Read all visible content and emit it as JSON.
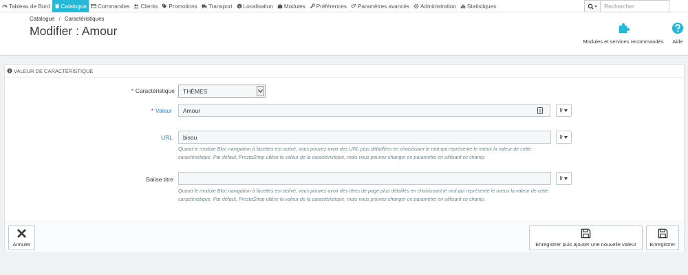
{
  "nav": {
    "tabs": [
      {
        "label": "Tableau de Bord",
        "icon": "speedometer-icon"
      },
      {
        "label": "Catalogue",
        "icon": "book-icon",
        "active": true
      },
      {
        "label": "Commandes",
        "icon": "credit-card-icon"
      },
      {
        "label": "Clients",
        "icon": "users-icon"
      },
      {
        "label": "Promotions",
        "icon": "tag-icon"
      },
      {
        "label": "Transport",
        "icon": "truck-icon"
      },
      {
        "label": "Localisation",
        "icon": "globe-icon"
      },
      {
        "label": "Modules",
        "icon": "puzzle-icon"
      },
      {
        "label": "Préférences",
        "icon": "wrench-icon"
      },
      {
        "label": "Paramètres avancés",
        "icon": "cogs-icon"
      },
      {
        "label": "Administration",
        "icon": "gear-icon"
      },
      {
        "label": "Statistiques",
        "icon": "bar-chart-icon"
      }
    ],
    "search_placeholder": "Rechercher"
  },
  "header": {
    "breadcrumb": [
      "Catalogue",
      "Caractéristiques"
    ],
    "breadcrumb_sep": "/",
    "title": "Modifier : Amour",
    "modules_label": "Modules et services recommandés",
    "help_label": "Aide"
  },
  "panel": {
    "heading": "VALEUR DE CARACTÉRISTIQUE",
    "required_mark": "*",
    "feature_label": "Caractéristique",
    "feature_value": "THÈMES",
    "value_label": "Valeur",
    "value_value": "Amour",
    "url_label": "URL",
    "url_value": "bisou",
    "url_help": "Quand le module Bloc navigation à facettes est activé, vous pouvez avoir des URL plus détaillées en choisissant le mot qui représente le mieux la valeur de cette caractéristique. Par défaut, PrestaShop utilise la valeur de la caractéristique, mais vous pouvez changer ce paramètre en utilisant ce champ.",
    "title_label": "Balise titre",
    "title_value": "",
    "title_help": "Quand le module Bloc navigation à facettes est activé, vous pouvez avoir des titres de page plus détaillés en choisissant le mot qui représente le mieux la valeur de cette caractéristique. Par défaut, PrestaShop utilise la valeur de la caractéristique, mais vous pouvez changer ce paramètre en utilisant ce champ.",
    "lang": "fr"
  },
  "footer": {
    "cancel_label": "Annuler",
    "save_add_label": "Enregistrer puis ajouter une nouvelle valeur",
    "save_label": "Enregistrer"
  },
  "colors": {
    "accent": "#25b9d7",
    "required": "#c7254e",
    "link": "#2a7cbd",
    "help_text": "#6c868e"
  }
}
